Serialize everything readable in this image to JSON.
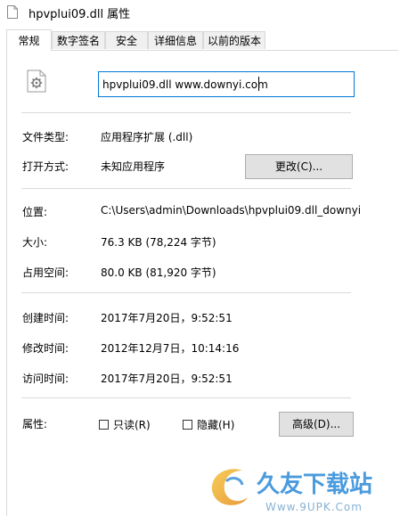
{
  "window": {
    "title": "hpvplui09.dll 属性"
  },
  "tabs": [
    {
      "label": "常规"
    },
    {
      "label": "数字签名"
    },
    {
      "label": "安全"
    },
    {
      "label": "详细信息"
    },
    {
      "label": "以前的版本"
    }
  ],
  "general": {
    "file_name": "hpvplui09.dll www.downyi.com",
    "file_type_label": "文件类型:",
    "file_type_value": "应用程序扩展 (.dll)",
    "opens_with_label": "打开方式:",
    "opens_with_value": "未知应用程序",
    "change_button": "更改(C)...",
    "location_label": "位置:",
    "location_value": "C:\\Users\\admin\\Downloads\\hpvplui09.dll_downyi.",
    "size_label": "大小:",
    "size_value": "76.3 KB (78,224 字节)",
    "size_on_disk_label": "占用空间:",
    "size_on_disk_value": "80.0 KB (81,920 字节)",
    "created_label": "创建时间:",
    "created_value": "2017年7月20日，9:52:51",
    "modified_label": "修改时间:",
    "modified_value": "2012年12月7日，10:14:16",
    "accessed_label": "访问时间:",
    "accessed_value": "2017年7月20日，9:52:51",
    "attributes_label": "属性:",
    "readonly_label": "只读(R)",
    "hidden_label": "隐藏(H)",
    "advanced_button": "高级(D)..."
  },
  "watermark": {
    "brand": "久友下载站",
    "url": "Www.9UPK.Com"
  },
  "colors": {
    "accent": "#0078d7",
    "border": "#d9d9d9",
    "button_bg": "#e1e1e1"
  }
}
